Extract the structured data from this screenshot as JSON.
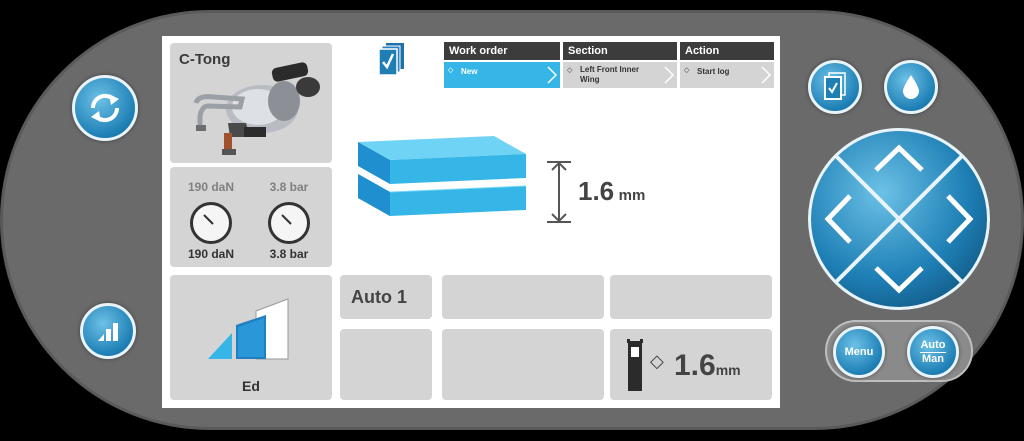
{
  "tool": {
    "name": "C-Tong"
  },
  "gauges": {
    "force_set": "190 daN",
    "pressure_set": "3.8 bar",
    "force_actual": "190 daN",
    "pressure_actual": "3.8 bar"
  },
  "work_table": {
    "headers": [
      "Work order",
      "Section",
      "Action"
    ],
    "values": [
      {
        "text": "New",
        "selected": true
      },
      {
        "text": "Left Front Inner Wing",
        "selected": false
      },
      {
        "text": "Start log",
        "selected": false
      }
    ]
  },
  "thickness": {
    "value": "1.6",
    "unit": "mm"
  },
  "mode": {
    "label": "Auto 1"
  },
  "ed": {
    "label": "Ed"
  },
  "electrode": {
    "value": "1.6",
    "unit": "mm"
  },
  "buttons": {
    "menu": "Menu",
    "auto": "Auto",
    "man": "Man"
  },
  "icons": [
    "refresh-icon",
    "bar-chart-icon",
    "document-check-icon",
    "drop-icon",
    "arrow-up-icon",
    "arrow-down-icon",
    "arrow-left-icon",
    "arrow-right-icon"
  ],
  "colors": {
    "accent": "#36b6e6",
    "button": "#1e7fb5",
    "device": "#6a6a6a",
    "header": "#3c3c3c",
    "tile": "#d4d4d4"
  }
}
